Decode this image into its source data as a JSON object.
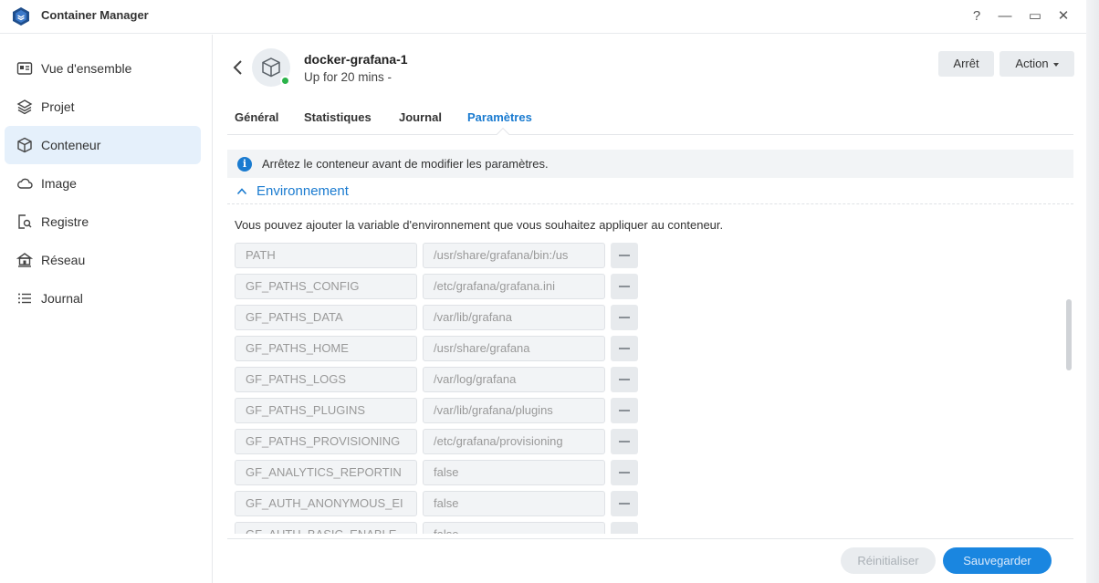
{
  "window": {
    "title": "Container Manager",
    "controls": {
      "help": "?",
      "minimize": "—",
      "maximize": "▭",
      "close": "✕"
    }
  },
  "sidebar": {
    "items": [
      {
        "label": "Vue d'ensemble",
        "icon": "overview-icon",
        "active": false
      },
      {
        "label": "Projet",
        "icon": "layers-icon",
        "active": false
      },
      {
        "label": "Conteneur",
        "icon": "cube-icon",
        "active": true
      },
      {
        "label": "Image",
        "icon": "cloud-icon",
        "active": false
      },
      {
        "label": "Registre",
        "icon": "registry-search-icon",
        "active": false
      },
      {
        "label": "Réseau",
        "icon": "network-house-icon",
        "active": false
      },
      {
        "label": "Journal",
        "icon": "list-icon",
        "active": false
      }
    ]
  },
  "container": {
    "name": "docker-grafana-1",
    "status": "Up for 20 mins -",
    "running_color": "#2bb34a"
  },
  "actions": {
    "stop_label": "Arrêt",
    "action_label": "Action"
  },
  "tabs": [
    {
      "label": "Général",
      "active": false
    },
    {
      "label": "Statistiques",
      "active": false
    },
    {
      "label": "Journal",
      "active": false
    },
    {
      "label": "Paramètres",
      "active": true
    }
  ],
  "info": {
    "icon": "i",
    "text": "Arrêtez le conteneur avant de modifier les paramètres."
  },
  "section": {
    "title": "Environnement",
    "description": "Vous pouvez ajouter la variable d'environnement que vous souhaitez appliquer au conteneur."
  },
  "env_vars": [
    {
      "key": "PATH",
      "value": "/usr/share/grafana/bin:/us"
    },
    {
      "key": "GF_PATHS_CONFIG",
      "value": "/etc/grafana/grafana.ini"
    },
    {
      "key": "GF_PATHS_DATA",
      "value": "/var/lib/grafana"
    },
    {
      "key": "GF_PATHS_HOME",
      "value": "/usr/share/grafana"
    },
    {
      "key": "GF_PATHS_LOGS",
      "value": "/var/log/grafana"
    },
    {
      "key": "GF_PATHS_PLUGINS",
      "value": "/var/lib/grafana/plugins"
    },
    {
      "key": "GF_PATHS_PROVISIONING",
      "value": "/etc/grafana/provisioning"
    },
    {
      "key": "GF_ANALYTICS_REPORTIN",
      "value": "false"
    },
    {
      "key": "GF_AUTH_ANONYMOUS_EI",
      "value": "false"
    },
    {
      "key": "GF_AUTH_BASIC_ENABLE",
      "value": "false"
    }
  ],
  "footer": {
    "reset_label": "Réinitialiser",
    "save_label": "Sauvegarder"
  },
  "colors": {
    "accent": "#1a7bd0",
    "active_sidebar_bg": "#e5f0fb"
  }
}
